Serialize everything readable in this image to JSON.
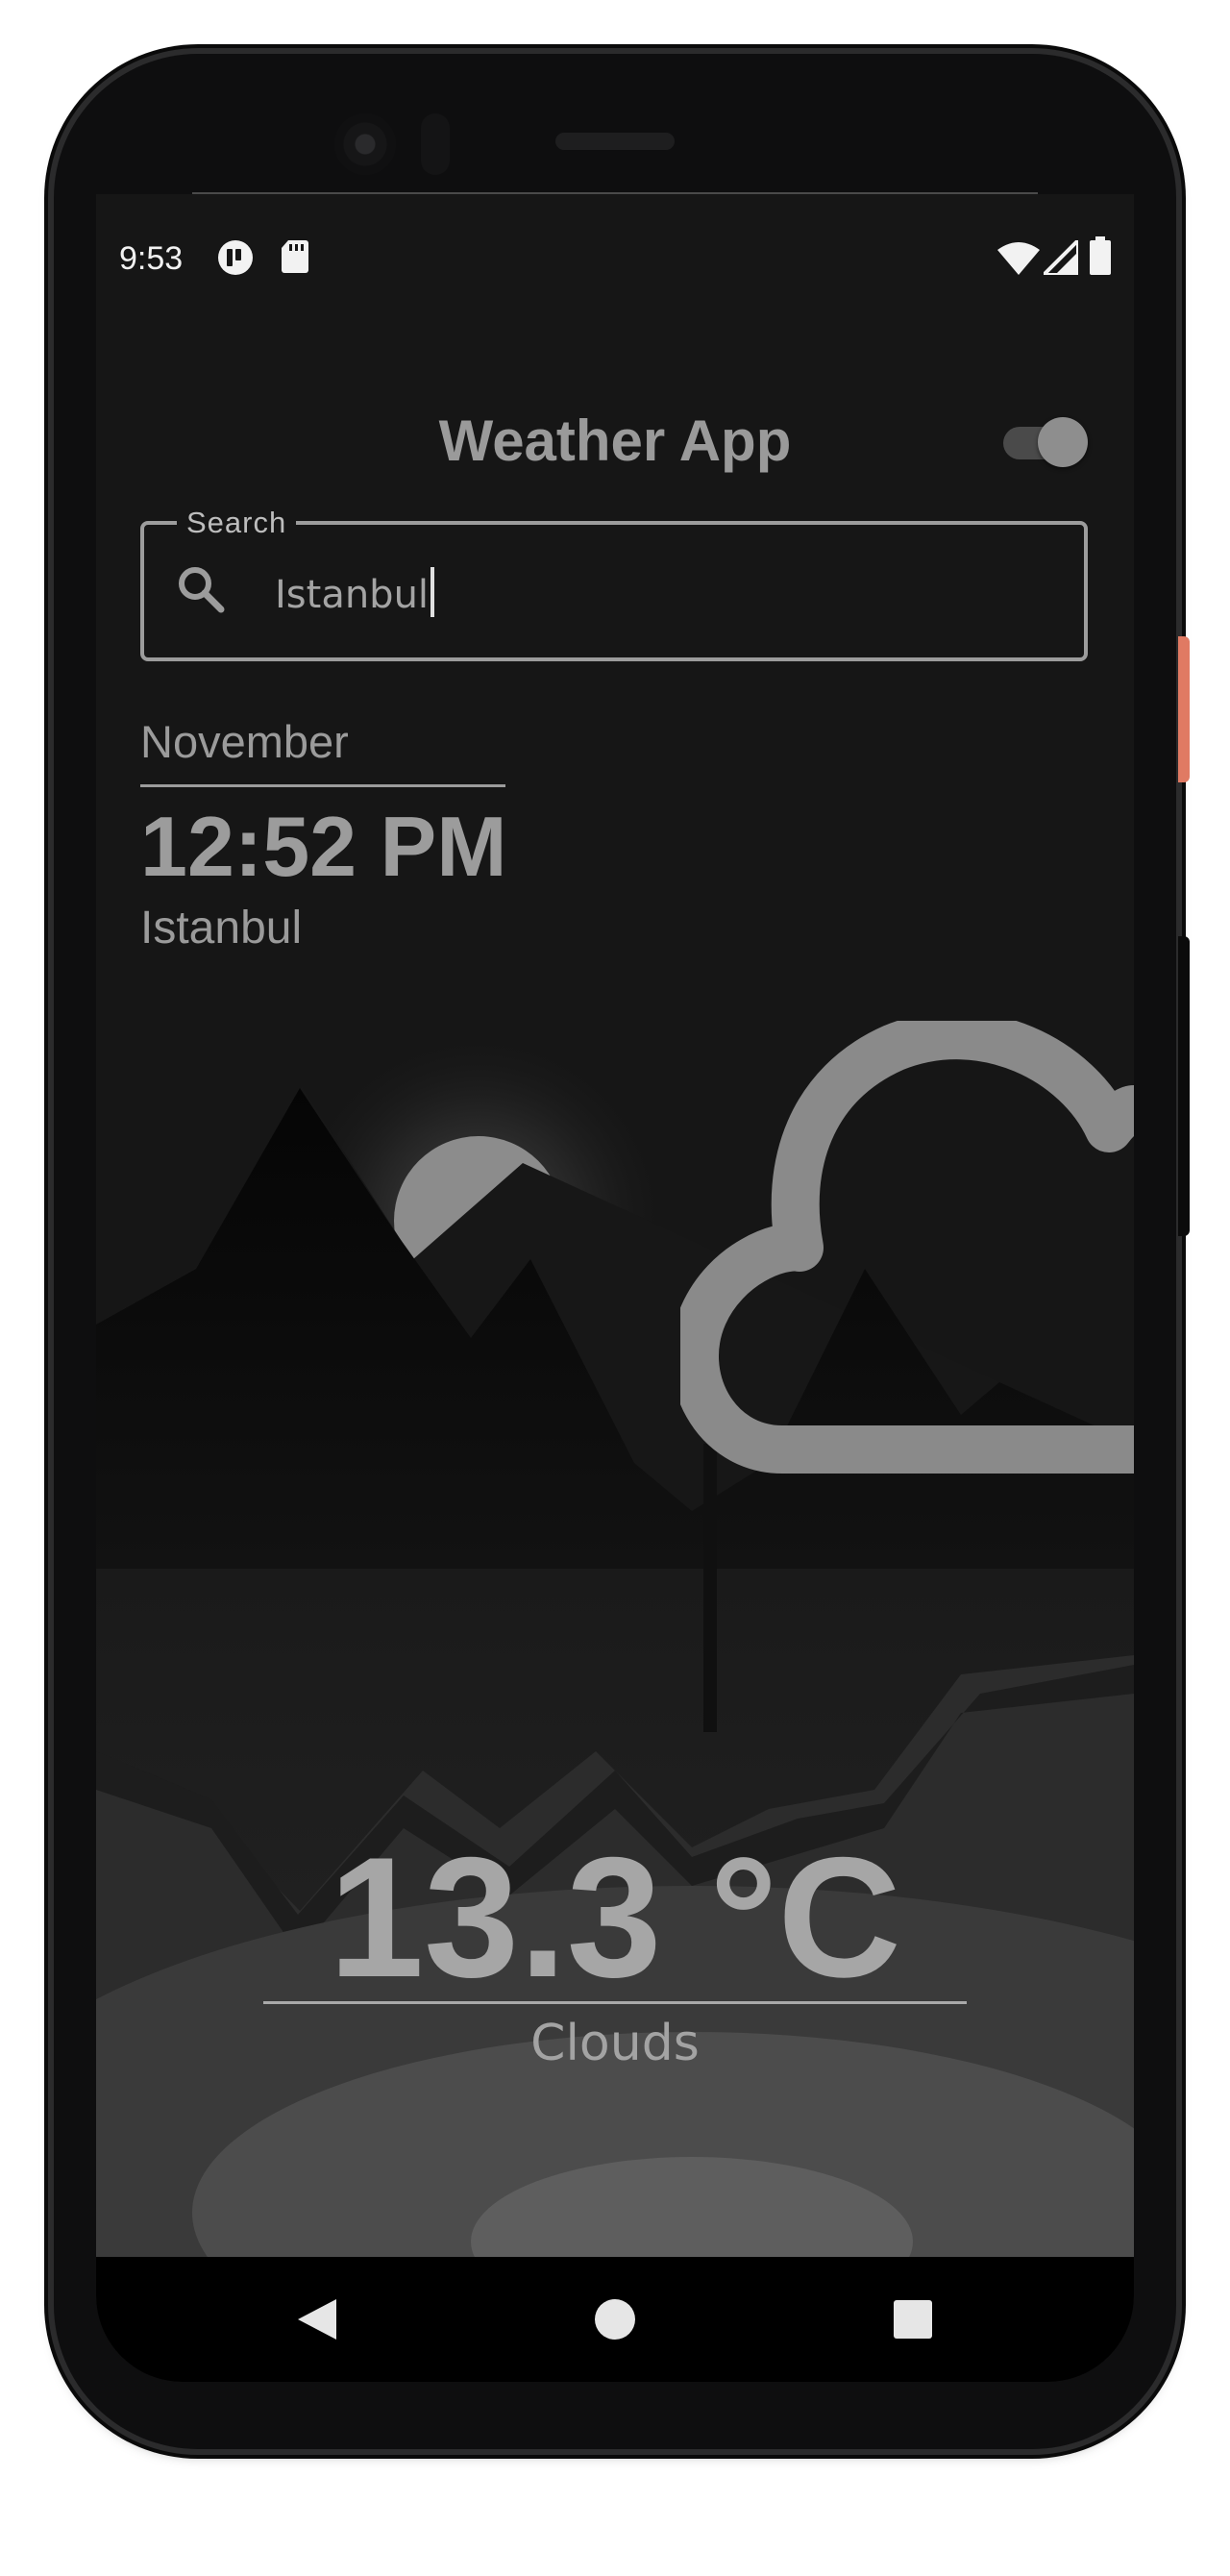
{
  "status_bar": {
    "time": "9:53",
    "notification_icons": [
      "app-notification-icon",
      "sd-card-icon"
    ],
    "system_icons": [
      "wifi-icon",
      "cell-signal-icon",
      "battery-icon"
    ]
  },
  "app": {
    "title": "Weather App",
    "theme_toggle": {
      "icon": "toggle-switch",
      "on": true
    }
  },
  "search": {
    "label": "Search",
    "value": "Istanbul",
    "icon": "search-icon"
  },
  "info": {
    "month": "November",
    "time": "12:52 PM",
    "city": "Istanbul"
  },
  "weather": {
    "icon": "cloud-icon",
    "temperature": "13.3 °C",
    "condition": "Clouds"
  },
  "nav_bar": {
    "buttons": [
      "back-icon",
      "home-icon",
      "recents-icon"
    ]
  },
  "colors": {
    "background": "#161616",
    "text": "#9b9b9b",
    "accent_button": "#e07a63"
  }
}
